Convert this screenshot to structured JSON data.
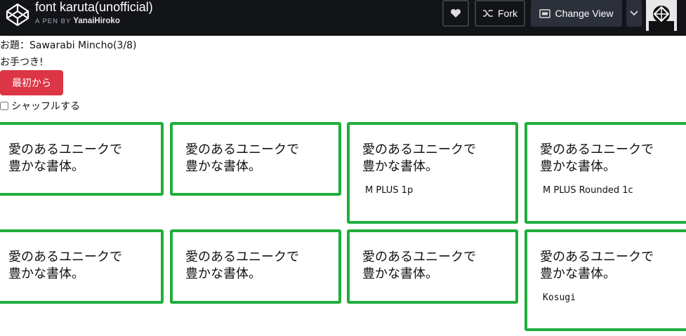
{
  "header": {
    "title": "font karuta(unofficial)",
    "byline_prefix": "A PEN BY",
    "author": "YanaiHiroko",
    "fork_label": "Fork",
    "change_view_label": "Change View"
  },
  "game": {
    "topic": "お題：Sawarabi Mincho(3/8)",
    "status": "お手つき!",
    "reset_button": "最初から",
    "shuffle_label": "シャッフルする"
  },
  "cards": [
    {
      "phrase": "愛のあるユニークで\n豊かな書体。",
      "font_name": ""
    },
    {
      "phrase": "愛のあるユニークで\n豊かな書体。",
      "font_name": ""
    },
    {
      "phrase": "愛のあるユニークで\n豊かな書体。",
      "font_name": "M PLUS 1p"
    },
    {
      "phrase": "愛のあるユニークで\n豊かな書体。",
      "font_name": "M PLUS Rounded 1c"
    },
    {
      "phrase": "愛のあるユニークで\n豊かな書体。",
      "font_name": ""
    },
    {
      "phrase": "愛のあるユニークで\n豊かな書体。",
      "font_name": ""
    },
    {
      "phrase": "愛のあるユニークで\n豊かな書体。",
      "font_name": ""
    },
    {
      "phrase": "愛のあるユニークで\n豊かな書体。",
      "font_name": "Kosugi"
    }
  ],
  "colors": {
    "card_border": "#1fae3a",
    "reset_button": "#dc3545",
    "topbar": "#131417"
  },
  "icons": [
    "codepen-logo-icon",
    "heart-icon",
    "fork-icon",
    "change-view-icon",
    "chevron-down-icon"
  ]
}
